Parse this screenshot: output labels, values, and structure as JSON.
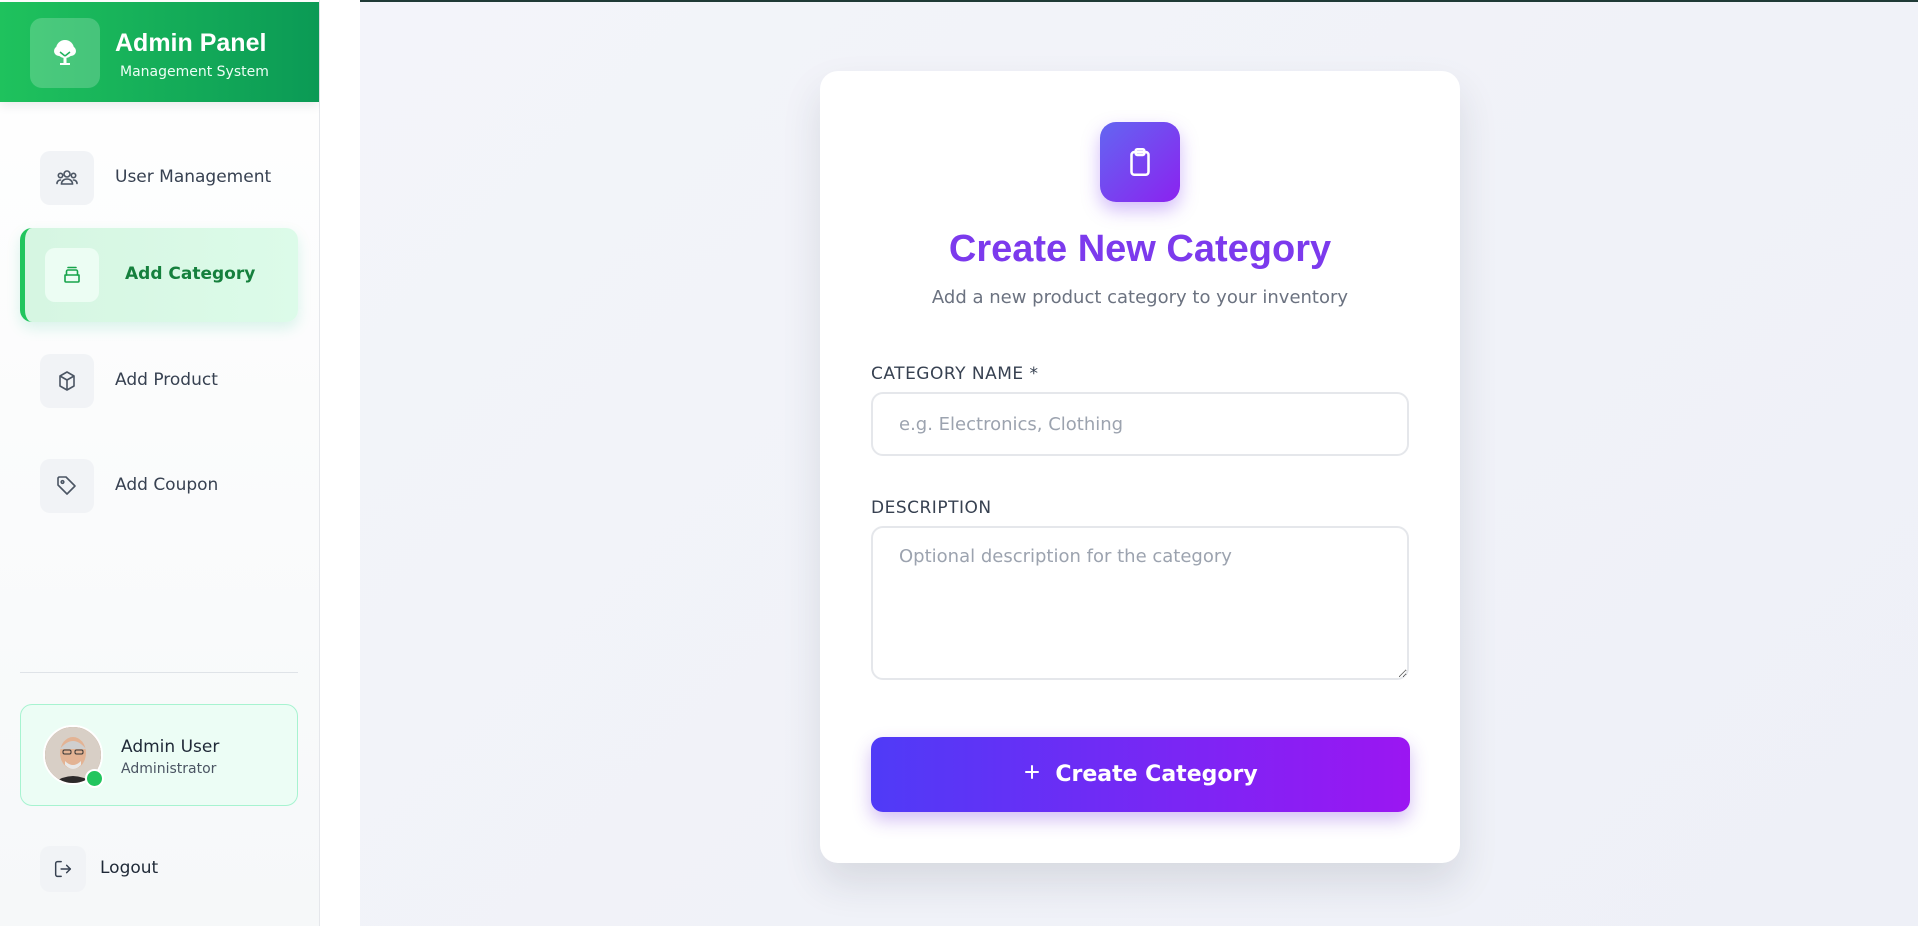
{
  "brand": {
    "title": "Admin Panel",
    "subtitle": "Management System",
    "logo_icon": "tree-icon",
    "gradient": [
      "#1fc25d",
      "#0b9a55"
    ]
  },
  "sidebar": {
    "items": [
      {
        "label": "User Management",
        "icon": "users-icon",
        "active": false
      },
      {
        "label": "Add Category",
        "icon": "inbox-icon",
        "active": true
      },
      {
        "label": "Add Product",
        "icon": "box-icon",
        "active": false
      },
      {
        "label": "Add Coupon",
        "icon": "tag-icon",
        "active": false
      }
    ],
    "active_color": "#15803d"
  },
  "user": {
    "name": "Admin User",
    "role": "Administrator",
    "status": "online"
  },
  "logout": {
    "label": "Logout",
    "icon": "logout-icon"
  },
  "form": {
    "icon": "clipboard-icon",
    "title": "Create New Category",
    "subtitle": "Add a new product category to your inventory",
    "name_label": "CATEGORY NAME *",
    "name_placeholder": "e.g. Electronics, Clothing",
    "name_value": "",
    "description_label": "DESCRIPTION",
    "description_placeholder": "Optional description for the category",
    "description_value": "",
    "submit_label": "Create Category",
    "submit_gradient": [
      "#4f3bf7",
      "#9b16f2"
    ],
    "title_color": "#7c3aed"
  }
}
